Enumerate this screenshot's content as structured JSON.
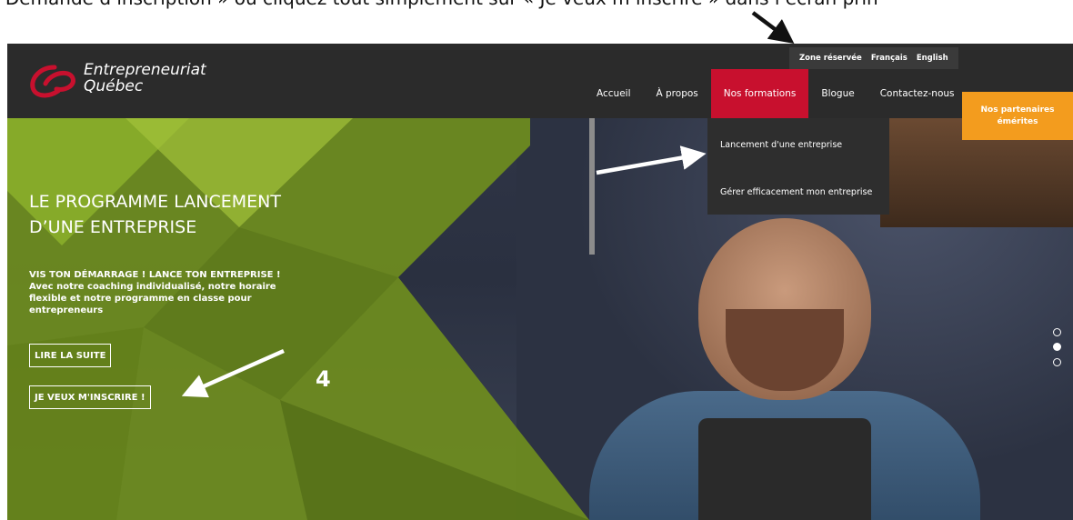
{
  "caption": "ur « Demande d’inscription » ou cliquez tout simplement sur « Je veux m’inscrire » dans l’écran prin",
  "brand": {
    "line1": "Entrepreneuriat",
    "line2": "Québec"
  },
  "utility_nav": [
    "Zone réservée",
    "Français",
    "English"
  ],
  "main_nav": [
    {
      "label": "Accueil"
    },
    {
      "label": "À propos"
    },
    {
      "label": "Nos formations",
      "active": true
    },
    {
      "label": "Blogue"
    },
    {
      "label": "Contactez-nous"
    }
  ],
  "partners_button": {
    "line1": "Nos partenaires",
    "line2": "émérites"
  },
  "dropdown": {
    "items": [
      "Lancement d'une entreprise",
      "Gérer efficacement mon entreprise"
    ]
  },
  "hero": {
    "title": "LE PROGRAMME LANCEMENT D’UNE ENTREPRISE",
    "subtitle": "VIS TON DÉMARRAGE ! LANCE TON ENTREPRISE ! Avec notre coaching individualisé, notre horaire flexible et notre programme en classe pour entrepreneurs",
    "read_more": "LIRE LA SUITE",
    "signup": "JE VEUX M'INSCRIRE !"
  },
  "annotation_number": "4",
  "slider_dots": {
    "count": 3,
    "active_index": 1
  },
  "colors": {
    "nav_bg": "#2b2b2b",
    "active_red": "#c8102e",
    "partners_orange": "#f39c1e",
    "hero_green": "#8cb02a"
  },
  "icons": {
    "logo": "entrepreneuriat-quebec-logo-icon",
    "arrows": "annotation-arrow-icon"
  }
}
